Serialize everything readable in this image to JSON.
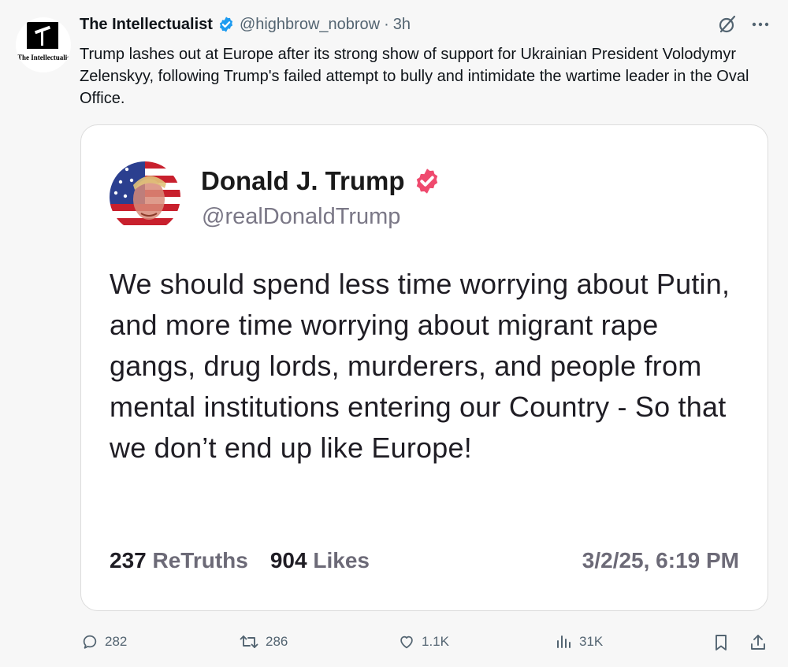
{
  "post": {
    "author": {
      "display_name": "The Intellectualist",
      "handle": "@highbrow_nobrow",
      "separator": "·",
      "time": "3h",
      "avatar_text": "The Intellectualist"
    },
    "text": "Trump lashes out at Europe after its strong show of support for Ukrainian President Volodymyr Zelenskyy, following Trump's failed attempt to bully and intimidate the wartime leader in the Oval Office.",
    "icons": {
      "verified": "verified-badge-icon",
      "grok": "grok-icon",
      "more": "more-icon"
    },
    "colors": {
      "verified_blue": "#1d9bf0",
      "truth_badge": "#ef4a6e",
      "secondary_text": "#536471"
    }
  },
  "quote": {
    "display_name": "Donald J. Trump",
    "handle": "@realDonaldTrump",
    "text": "We should spend less time worrying about Putin, and more time worrying about migrant rape gangs, drug lords, murderers, and people from mental institutions entering our Country - So that we don’t end up like Europe!",
    "retruths_count": "237",
    "retruths_label": "ReTruths",
    "likes_count": "904",
    "likes_label": "Likes",
    "date": "3/2/25, 6:19 PM"
  },
  "actions": {
    "replies": "282",
    "reposts": "286",
    "likes": "1.1K",
    "views": "31K"
  }
}
